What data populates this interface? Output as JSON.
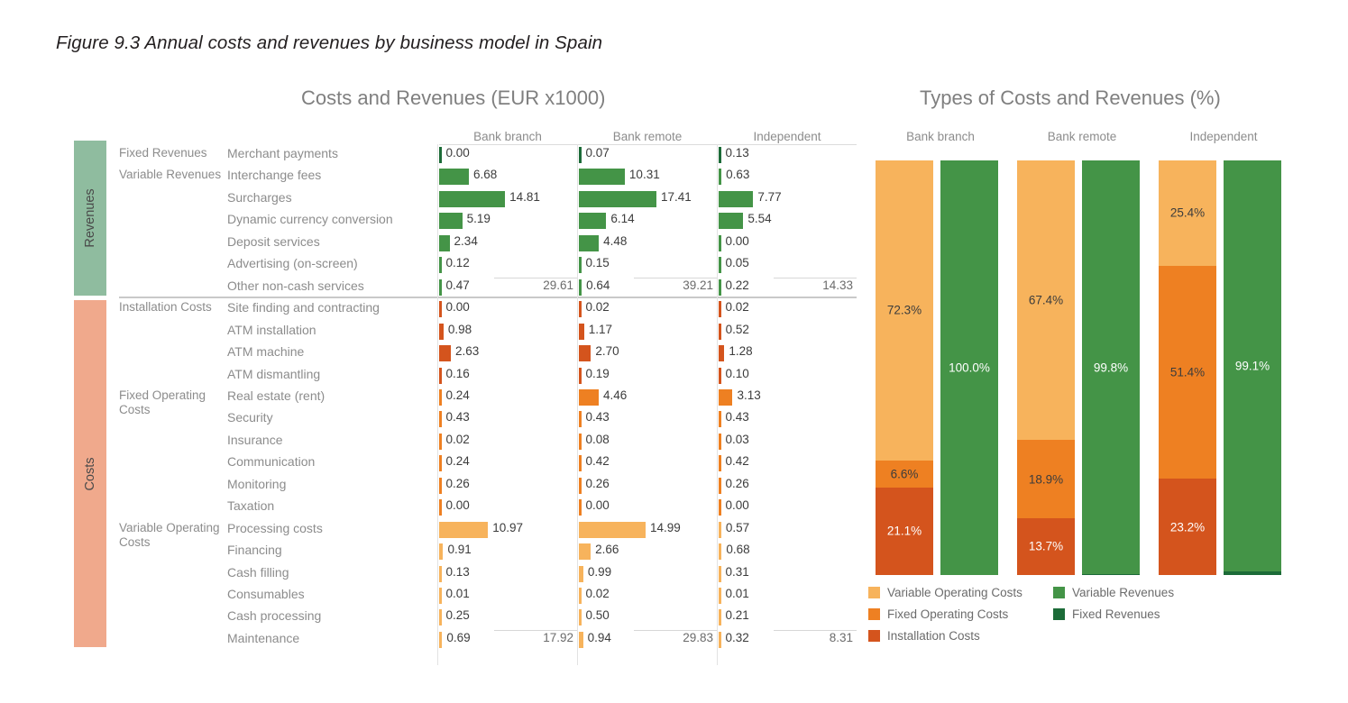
{
  "figure": {
    "title": "Figure 9.3 Annual costs and revenues by business model in Spain"
  },
  "left_chart": {
    "title": "Costs and Revenues (EUR x1000)",
    "columns": [
      "Bank branch",
      "Bank remote",
      "Independent"
    ],
    "side_bands": [
      {
        "label": "Revenues",
        "color": "#8fbc9f"
      },
      {
        "label": "Costs",
        "color": "#f0a98c"
      }
    ],
    "groups": [
      {
        "label": "Fixed Revenues"
      },
      {
        "label": "Variable Revenues"
      },
      {
        "label": "Installation Costs"
      },
      {
        "label": "Fixed Operating Costs"
      },
      {
        "label": "Variable Operating Costs"
      }
    ],
    "totals": {
      "revenues": [
        "29.61",
        "39.21",
        "14.33"
      ],
      "costs": [
        "17.92",
        "29.83",
        "8.31"
      ]
    }
  },
  "right_chart": {
    "title": "Types of Costs and Revenues (%)",
    "columns": [
      "Bank branch",
      "Bank remote",
      "Independent"
    ],
    "legend": [
      {
        "label": "Variable Operating Costs",
        "color": "#f7b35c"
      },
      {
        "label": "Fixed Operating Costs",
        "color": "#ee8022"
      },
      {
        "label": "Installation Costs",
        "color": "#d4541d"
      },
      {
        "label": "Variable Revenues",
        "color": "#449447"
      },
      {
        "label": "Fixed Revenues",
        "color": "#1c6b38"
      }
    ]
  },
  "chart_data": [
    {
      "type": "bar",
      "title": "Costs and Revenues (EUR x1000)",
      "orientation": "horizontal",
      "unit": "EUR x1000",
      "categories": [
        "Merchant payments",
        "Interchange fees",
        "Surcharges",
        "Dynamic currency conversion",
        "Deposit services",
        "Advertising (on-screen)",
        "Other non-cash services",
        "Site finding and contracting",
        "ATM installation",
        "ATM machine",
        "ATM dismantling",
        "Real estate (rent)",
        "Security",
        "Insurance",
        "Communication",
        "Monitoring",
        "Taxation",
        "Processing costs",
        "Financing",
        "Cash filling",
        "Consumables",
        "Cash processing",
        "Maintenance"
      ],
      "category_groups": [
        "Fixed Revenues",
        "Variable Revenues",
        "Variable Revenues",
        "Variable Revenues",
        "Variable Revenues",
        "Variable Revenues",
        "Variable Revenues",
        "Installation Costs",
        "Installation Costs",
        "Installation Costs",
        "Installation Costs",
        "Fixed Operating Costs",
        "Fixed Operating Costs",
        "Fixed Operating Costs",
        "Fixed Operating Costs",
        "Fixed Operating Costs",
        "Fixed Operating Costs",
        "Variable Operating Costs",
        "Variable Operating Costs",
        "Variable Operating Costs",
        "Variable Operating Costs",
        "Variable Operating Costs",
        "Variable Operating Costs"
      ],
      "series": [
        {
          "name": "Bank branch",
          "values": [
            0.0,
            6.68,
            14.81,
            5.19,
            2.34,
            0.12,
            0.47,
            0.0,
            0.98,
            2.63,
            0.16,
            0.24,
            0.43,
            0.02,
            0.24,
            0.26,
            0.0,
            10.97,
            0.91,
            0.13,
            0.01,
            0.25,
            0.69
          ],
          "labels": [
            "0.00",
            "6.68",
            "14.81",
            "5.19",
            "2.34",
            "0.12",
            "0.47",
            "0.00",
            "0.98",
            "2.63",
            "0.16",
            "0.24",
            "0.43",
            "0.02",
            "0.24",
            "0.26",
            "0.00",
            "10.97",
            "0.91",
            "0.13",
            "0.01",
            "0.25",
            "0.69"
          ]
        },
        {
          "name": "Bank remote",
          "values": [
            0.07,
            10.31,
            17.41,
            6.14,
            4.48,
            0.15,
            0.64,
            0.02,
            1.17,
            2.7,
            0.19,
            4.46,
            0.43,
            0.08,
            0.42,
            0.26,
            0.0,
            14.99,
            2.66,
            0.99,
            0.02,
            0.5,
            0.94
          ],
          "labels": [
            "0.07",
            "10.31",
            "17.41",
            "6.14",
            "4.48",
            "0.15",
            "0.64",
            "0.02",
            "1.17",
            "2.70",
            "0.19",
            "4.46",
            "0.43",
            "0.08",
            "0.42",
            "0.26",
            "0.00",
            "14.99",
            "2.66",
            "0.99",
            "0.02",
            "0.50",
            "0.94"
          ]
        },
        {
          "name": "Independent",
          "values": [
            0.13,
            0.63,
            7.77,
            5.54,
            0.0,
            0.05,
            0.22,
            0.02,
            0.52,
            1.28,
            0.1,
            3.13,
            0.43,
            0.03,
            0.42,
            0.26,
            0.0,
            0.57,
            0.68,
            0.31,
            0.01,
            0.21,
            0.32
          ],
          "labels": [
            "0.13",
            "0.63",
            "7.77",
            "5.54",
            "0.00",
            "0.05",
            "0.22",
            "0.02",
            "0.52",
            "1.28",
            "0.10",
            "3.13",
            "0.43",
            "0.03",
            "0.42",
            "0.26",
            "0.00",
            "0.57",
            "0.68",
            "0.31",
            "0.01",
            "0.21",
            "0.32"
          ]
        }
      ],
      "totals": {
        "Revenues": {
          "Bank branch": 29.61,
          "Bank remote": 39.21,
          "Independent": 14.33
        },
        "Costs": {
          "Bank branch": 17.92,
          "Bank remote": 29.83,
          "Independent": 8.31
        }
      },
      "colors": {
        "Fixed Revenues": "#1c6b38",
        "Variable Revenues": "#449447",
        "Installation Costs": "#d4541d",
        "Fixed Operating Costs": "#ee8022",
        "Variable Operating Costs": "#f7b35c"
      },
      "grid": false,
      "legend_position": "none"
    },
    {
      "type": "bar",
      "subtype": "stacked-100",
      "title": "Types of Costs and Revenues (%)",
      "ylabel": "%",
      "ylim": [
        0,
        100
      ],
      "categories": [
        "Bank branch Costs",
        "Bank branch Revenues",
        "Bank remote Costs",
        "Bank remote Revenues",
        "Independent Costs",
        "Independent Revenues"
      ],
      "groups": [
        "Bank branch",
        "Bank remote",
        "Independent"
      ],
      "bars": [
        {
          "group": "Bank branch",
          "kind": "Costs",
          "segments": [
            {
              "name": "Variable Operating Costs",
              "value": 72.3,
              "label": "72.3%",
              "color": "#f7b35c",
              "text_color": "#3c3c3c"
            },
            {
              "name": "Fixed Operating Costs",
              "value": 6.6,
              "label": "6.6%",
              "color": "#ee8022",
              "text_color": "#3c3c3c"
            },
            {
              "name": "Installation Costs",
              "value": 21.1,
              "label": "21.1%",
              "color": "#d4541d",
              "text_color": "#ffffff"
            }
          ]
        },
        {
          "group": "Bank branch",
          "kind": "Revenues",
          "segments": [
            {
              "name": "Variable Revenues",
              "value": 100.0,
              "label": "100.0%",
              "color": "#449447",
              "text_color": "#ffffff"
            }
          ]
        },
        {
          "group": "Bank remote",
          "kind": "Costs",
          "segments": [
            {
              "name": "Variable Operating Costs",
              "value": 67.4,
              "label": "67.4%",
              "color": "#f7b35c",
              "text_color": "#3c3c3c"
            },
            {
              "name": "Fixed Operating Costs",
              "value": 18.9,
              "label": "18.9%",
              "color": "#ee8022",
              "text_color": "#3c3c3c"
            },
            {
              "name": "Installation Costs",
              "value": 13.7,
              "label": "13.7%",
              "color": "#d4541d",
              "text_color": "#ffffff"
            }
          ]
        },
        {
          "group": "Bank remote",
          "kind": "Revenues",
          "segments": [
            {
              "name": "Variable Revenues",
              "value": 99.8,
              "label": "99.8%",
              "color": "#449447",
              "text_color": "#ffffff"
            },
            {
              "name": "Fixed Revenues",
              "value": 0.2,
              "label": "",
              "color": "#1c6b38",
              "text_color": "#ffffff"
            }
          ]
        },
        {
          "group": "Independent",
          "kind": "Costs",
          "segments": [
            {
              "name": "Variable Operating Costs",
              "value": 25.4,
              "label": "25.4%",
              "color": "#f7b35c",
              "text_color": "#3c3c3c"
            },
            {
              "name": "Fixed Operating Costs",
              "value": 51.4,
              "label": "51.4%",
              "color": "#ee8022",
              "text_color": "#3c3c3c"
            },
            {
              "name": "Installation Costs",
              "value": 23.2,
              "label": "23.2%",
              "color": "#d4541d",
              "text_color": "#ffffff"
            }
          ]
        },
        {
          "group": "Independent",
          "kind": "Revenues",
          "segments": [
            {
              "name": "Variable Revenues",
              "value": 99.1,
              "label": "99.1%",
              "color": "#449447",
              "text_color": "#ffffff"
            },
            {
              "name": "Fixed Revenues",
              "value": 0.9,
              "label": "",
              "color": "#1c6b38",
              "text_color": "#ffffff"
            }
          ]
        }
      ],
      "legend_position": "bottom-left"
    }
  ]
}
